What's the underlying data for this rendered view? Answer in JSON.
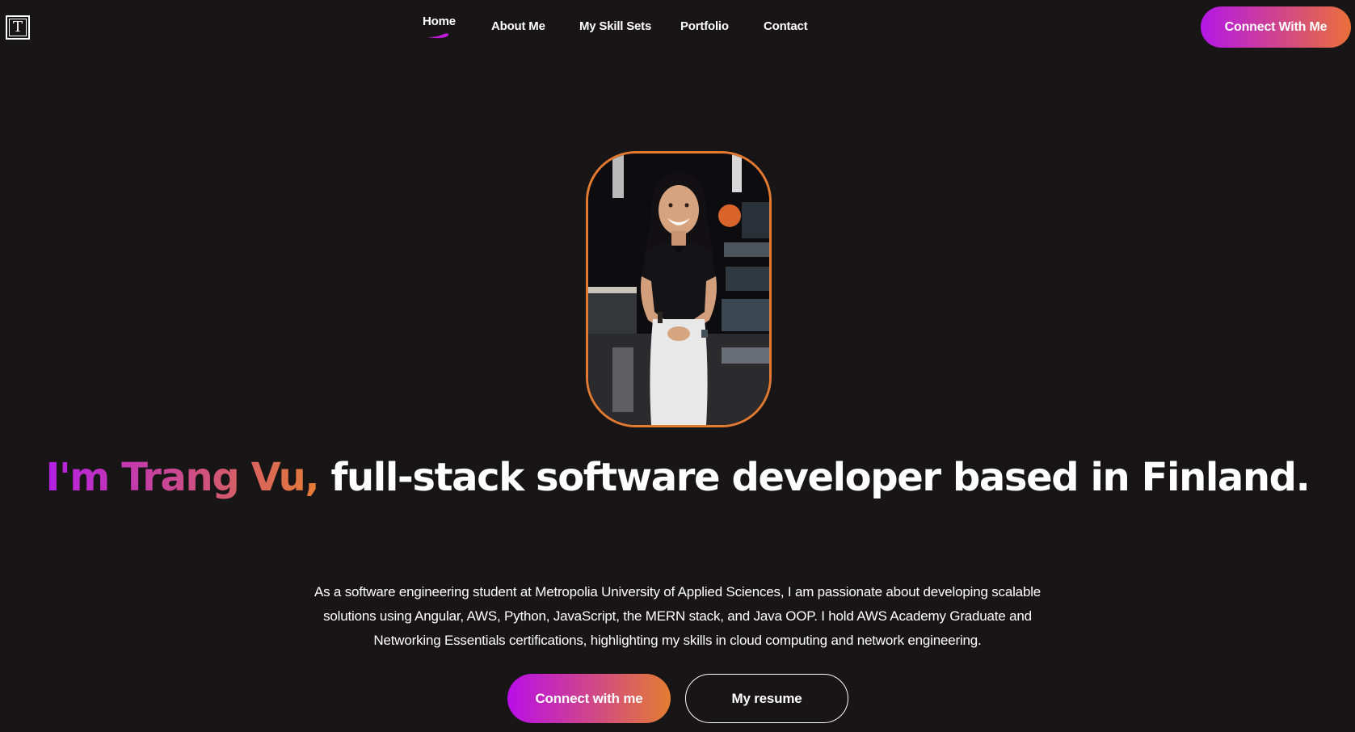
{
  "header": {
    "logo_letter": "T",
    "nav": [
      {
        "label": "Home",
        "active": true
      },
      {
        "label": "About Me",
        "active": false
      },
      {
        "label": "My Skill Sets",
        "active": false
      },
      {
        "label": "Portfolio",
        "active": false
      },
      {
        "label": "Contact",
        "active": false
      }
    ],
    "cta_label": "Connect With Me"
  },
  "hero": {
    "headline_name": "I'm Trang Vu,",
    "headline_rest": " full-stack software developer based in Finland.",
    "intro": "As a software engineering student at Metropolia University of Applied Sciences, I am passionate about developing scalable solutions using Angular, AWS, Python, JavaScript, the MERN stack, and Java OOP. I hold AWS Academy Graduate and Networking Essentials certifications, highlighting my skills in cloud computing and network engineering.",
    "primary_button": "Connect with me",
    "secondary_button": "My resume"
  },
  "theme": {
    "background": "#171515",
    "gradient_start": "#b417e6",
    "gradient_end": "#e9703a",
    "portrait_border": "#e37a31"
  }
}
